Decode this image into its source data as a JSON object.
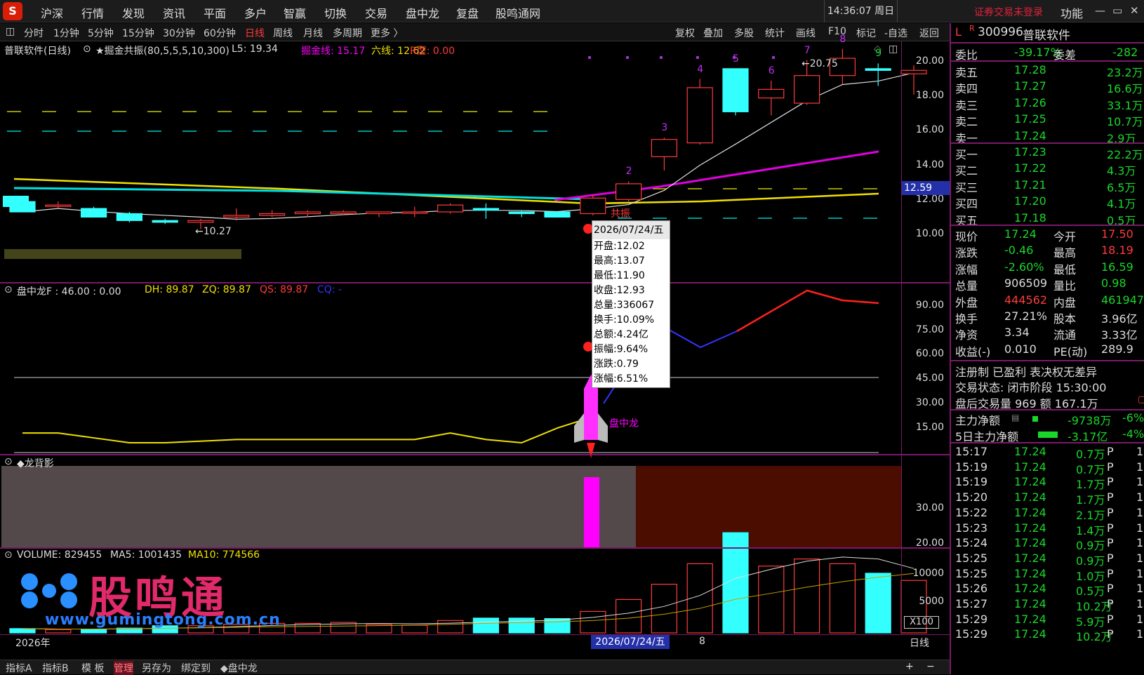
{
  "menubar": {
    "items": [
      "沪深",
      "行情",
      "发现",
      "资讯",
      "平面",
      "多户",
      "智赢",
      "切换",
      "交易",
      "盘中龙",
      "复盘",
      "股鸣通网"
    ],
    "clock": "14:36:07 周日",
    "login": "证券交易未登录",
    "func": "功能"
  },
  "toolbar": {
    "periods": [
      "分时",
      "1分钟",
      "5分钟",
      "15分钟",
      "30分钟",
      "60分钟",
      "日线",
      "周线",
      "月线",
      "多周期",
      "更多 〉"
    ],
    "active": "日线",
    "right": [
      "复权",
      "叠加",
      "多股",
      "统计",
      "画线",
      "F10",
      "标记",
      "-自选",
      "返回"
    ]
  },
  "main": {
    "title": "普联软件(日线)",
    "indicator": "★掘金共振(80,5,5,5,10,300)",
    "l5": "L5: 19.34",
    "jj": "掘金线: 15.17",
    "lx": "六线: 12.62",
    "rx": "R型: 0.00",
    "ticks": [
      "20.00",
      "18.00",
      "16.00",
      "14.00",
      "12.00",
      "10.00"
    ],
    "price_tag": "12.59",
    "low_label": "←10.27",
    "high_label": "←20.75",
    "seq": [
      "2",
      "3",
      "4",
      "5",
      "6",
      "7",
      "8",
      "9"
    ],
    "gongzhen": "共振"
  },
  "tooltip": {
    "date": "2026/07/24/五",
    "open": "开盘:12.02",
    "high": "最高:13.07",
    "low": "最低:11.90",
    "close": "收盘:12.93",
    "vol": "总量:336067",
    "turn": "换手:10.09%",
    "amt": "总额:4.24亿",
    "amp": "振幅:9.64%",
    "chg": "涨跌:0.79",
    "pct": "涨幅:6.51%"
  },
  "panel2": {
    "title": "盘中龙F : 46.00 : 0.00",
    "dh": "DH: 89.87",
    "zq": "ZQ: 89.87",
    "qs": "QS: 89.87",
    "cq": "CQ: -",
    "ticks": [
      "90.00",
      "75.00",
      "60.00",
      "45.00",
      "30.00",
      "15.00"
    ],
    "rocket_label": "盘中龙"
  },
  "panel3": {
    "title": "◆龙背影",
    "ticks": [
      "30.00",
      "20.00"
    ]
  },
  "panel4": {
    "title": "VOLUME: 829455",
    "ma5": "MA5: 1001435",
    "ma10": "MA10: 774566",
    "ticks": [
      "10000",
      "5000"
    ],
    "unit": "X100",
    "watermark": "股鸣通",
    "url": "www.gumingtong.com.cn"
  },
  "xaxis": {
    "year": "2026年",
    "date": "2026/07/24/五",
    "n": "8",
    "period": "日线"
  },
  "bottombar": {
    "items": [
      "指标A",
      "指标B",
      "模 板",
      "管理",
      "另存为",
      "绑定到",
      "◆盘中龙"
    ],
    "plus": "+",
    "minus": "−"
  },
  "quote": {
    "code": "300996",
    "name": "普联软件",
    "weibi_l": "委比",
    "weibi": "-39.17%",
    "weicha_l": "委差",
    "weicha": "-282",
    "asks": [
      [
        "卖五",
        "17.28",
        "23.2万"
      ],
      [
        "卖四",
        "17.27",
        "16.6万"
      ],
      [
        "卖三",
        "17.26",
        "33.1万"
      ],
      [
        "卖二",
        "17.25",
        "10.7万"
      ],
      [
        "卖一",
        "17.24",
        "2.9万"
      ]
    ],
    "bids": [
      [
        "买一",
        "17.23",
        "22.2万"
      ],
      [
        "买二",
        "17.22",
        "4.3万"
      ],
      [
        "买三",
        "17.21",
        "6.5万"
      ],
      [
        "买四",
        "17.20",
        "4.1万"
      ],
      [
        "买五",
        "17.18",
        "0.5万"
      ]
    ],
    "stats": [
      [
        "现价",
        "17.24",
        "今开",
        "17.50"
      ],
      [
        "涨跌",
        "-0.46",
        "最高",
        "18.19"
      ],
      [
        "涨幅",
        "-2.60%",
        "最低",
        "16.59"
      ],
      [
        "总量",
        "906509",
        "量比",
        "0.98"
      ],
      [
        "外盘",
        "444562",
        "内盘",
        "461947"
      ],
      [
        "换手",
        "27.21%",
        "股本",
        "3.96亿"
      ],
      [
        "净资",
        "3.34",
        "流通",
        "3.33亿"
      ],
      [
        "收益(-)",
        "0.010",
        "PE(动)",
        "289.9"
      ]
    ],
    "tags": "注册制 已盈利 表决权无差异",
    "state": "交易状态: 闭市阶段 15:30:00",
    "after": "盘后交易量 969 额 167.1万",
    "flow1": [
      "主力净额",
      "-9738万",
      "-6%"
    ],
    "flow2": [
      "5日主力净额",
      "-3.17亿",
      "-4%"
    ],
    "ticks": [
      [
        "15:17",
        "17.24",
        "0.7万",
        "P",
        "1"
      ],
      [
        "15:19",
        "17.24",
        "0.7万",
        "P",
        "1"
      ],
      [
        "15:19",
        "17.24",
        "1.7万",
        "P",
        "1"
      ],
      [
        "15:20",
        "17.24",
        "1.7万",
        "P",
        "1"
      ],
      [
        "15:22",
        "17.24",
        "2.1万",
        "P",
        "1"
      ],
      [
        "15:23",
        "17.24",
        "1.4万",
        "P",
        "1"
      ],
      [
        "15:24",
        "17.24",
        "0.9万",
        "P",
        "1"
      ],
      [
        "15:25",
        "17.24",
        "0.9万",
        "P",
        "1"
      ],
      [
        "15:25",
        "17.24",
        "1.0万",
        "P",
        "1"
      ],
      [
        "15:26",
        "17.24",
        "0.5万",
        "P",
        "1"
      ],
      [
        "15:27",
        "17.24",
        "10.2万",
        "P",
        "1"
      ],
      [
        "15:29",
        "17.24",
        "5.9万",
        "P",
        "1"
      ],
      [
        "15:29",
        "17.24",
        "10.2万",
        "P",
        "1"
      ]
    ]
  },
  "candles": [
    {
      "o": 11.9,
      "c": 11.3,
      "h": 12.0,
      "l": 11.3
    },
    {
      "o": 11.7,
      "c": 11.7,
      "h": 11.9,
      "l": 11.5
    },
    {
      "o": 11.5,
      "c": 11.0,
      "h": 11.6,
      "l": 11.0
    },
    {
      "o": 11.2,
      "c": 10.8,
      "h": 11.3,
      "l": 10.7
    },
    {
      "o": 10.8,
      "c": 10.7,
      "h": 10.9,
      "l": 10.6
    },
    {
      "o": 10.7,
      "c": 10.8,
      "h": 10.9,
      "l": 10.3
    },
    {
      "o": 11.0,
      "c": 11.1,
      "h": 11.5,
      "l": 10.8
    },
    {
      "o": 11.1,
      "c": 11.2,
      "h": 11.4,
      "l": 11.0
    },
    {
      "o": 11.2,
      "c": 11.3,
      "h": 11.4,
      "l": 11.0
    },
    {
      "o": 11.2,
      "c": 11.3,
      "h": 11.4,
      "l": 11.1
    },
    {
      "o": 11.2,
      "c": 11.3,
      "h": 11.3,
      "l": 11.0
    },
    {
      "o": 11.3,
      "c": 11.3,
      "h": 11.6,
      "l": 11.0
    },
    {
      "o": 11.3,
      "c": 11.7,
      "h": 11.8,
      "l": 11.2
    },
    {
      "o": 11.5,
      "c": 11.4,
      "h": 11.8,
      "l": 10.9
    },
    {
      "o": 11.3,
      "c": 11.2,
      "h": 11.4,
      "l": 11.0
    },
    {
      "o": 11.3,
      "c": 11.0,
      "h": 11.3,
      "l": 11.0
    },
    {
      "o": 11.2,
      "c": 12.1,
      "h": 12.3,
      "l": 11.1
    },
    {
      "o": 12.02,
      "c": 12.93,
      "h": 13.07,
      "l": 11.9
    },
    {
      "o": 14.5,
      "c": 15.5,
      "h": 15.6,
      "l": 13.7
    },
    {
      "o": 15.3,
      "c": 18.5,
      "h": 19.0,
      "l": 15.2
    },
    {
      "o": 19.6,
      "c": 17.1,
      "h": 19.6,
      "l": 16.9
    },
    {
      "o": 17.9,
      "c": 18.4,
      "h": 18.9,
      "l": 16.9
    },
    {
      "o": 17.6,
      "c": 19.2,
      "h": 20.1,
      "l": 17.5
    },
    {
      "o": 19.2,
      "c": 20.2,
      "h": 20.75,
      "l": 18.7
    },
    {
      "o": 19.6,
      "c": 19.5,
      "h": 19.9,
      "l": 18.6
    },
    {
      "o": 19.3,
      "c": 19.5,
      "h": 19.8,
      "l": 18.1
    }
  ],
  "volumes": [
    900,
    700,
    800,
    1000,
    1500,
    1500,
    1800,
    2000,
    2000,
    2200,
    1800,
    1600,
    2600,
    3100,
    3100,
    3000,
    4500,
    7000,
    10200,
    14500,
    21000,
    14000,
    15500,
    14500,
    12500,
    11000
  ]
}
